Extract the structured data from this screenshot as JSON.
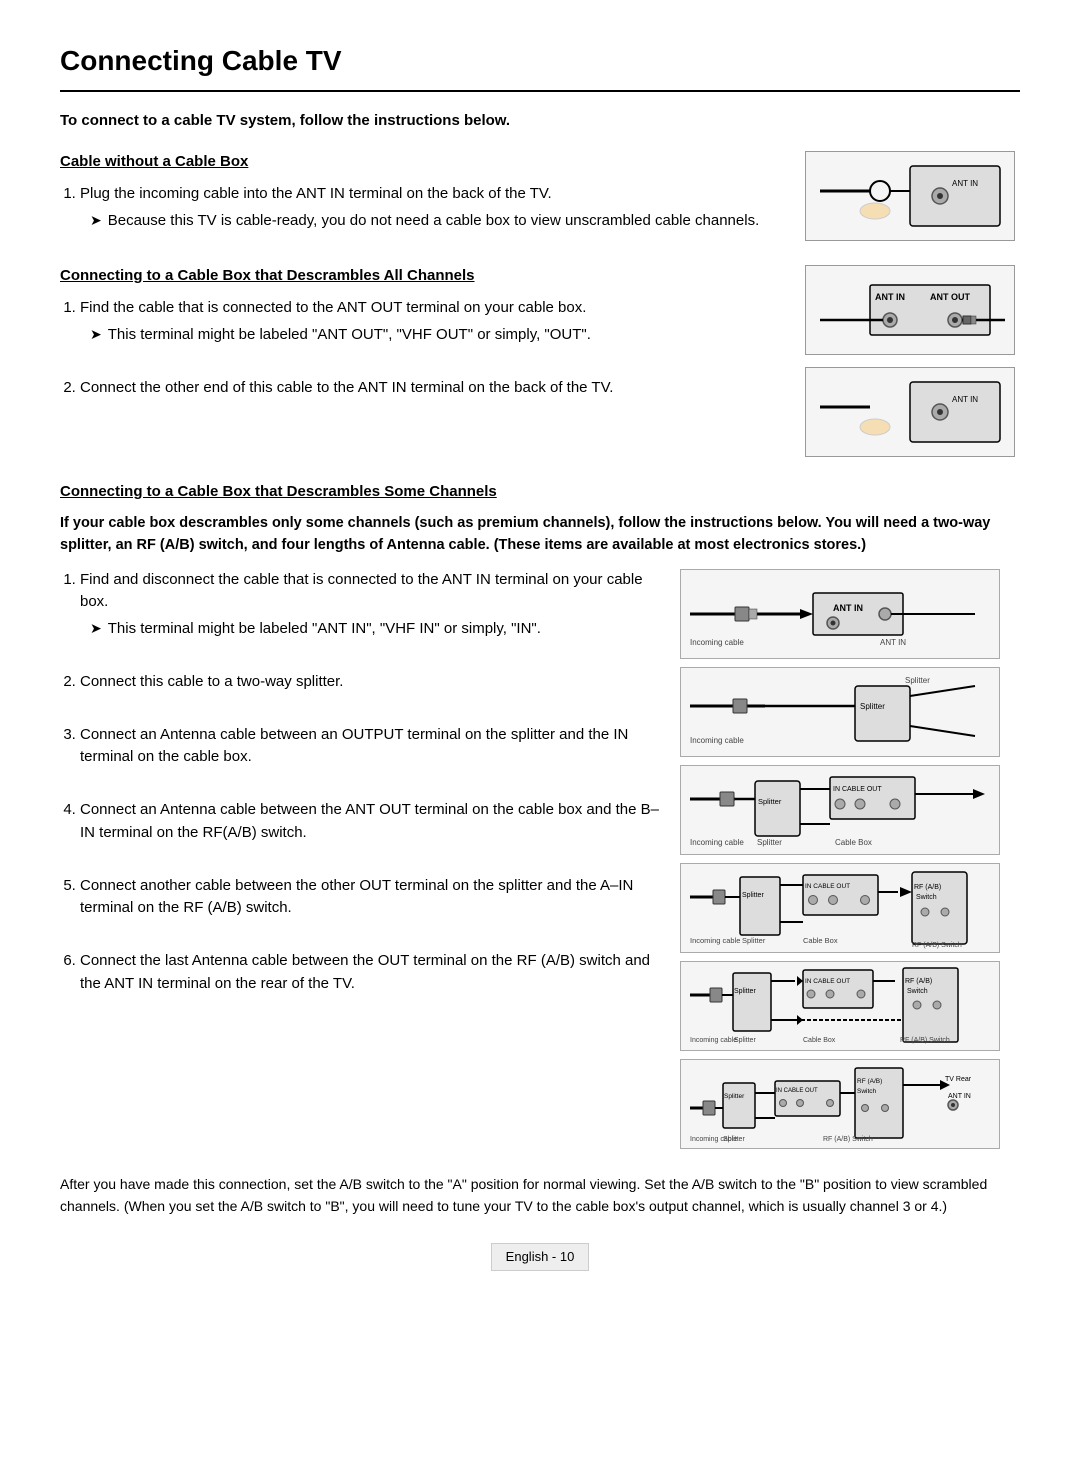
{
  "page": {
    "title": "Connecting Cable TV",
    "intro": "To connect to a cable TV system, follow the instructions below.",
    "section1": {
      "heading": "Cable without a Cable Box",
      "steps": [
        {
          "num": "1",
          "text": "Plug the incoming cable into the ANT IN terminal on the back of the TV.",
          "sub": "Because this TV is cable-ready, you do not need a cable box to view unscrambled cable channels."
        }
      ]
    },
    "section2": {
      "heading": "Connecting to a Cable Box that Descrambles All Channels",
      "steps": [
        {
          "num": "1",
          "text": "Find the cable that is connected to the ANT OUT terminal on your cable box.",
          "sub": "This terminal might be labeled \"ANT OUT\", \"VHF OUT\" or simply, \"OUT\"."
        },
        {
          "num": "2",
          "text": "Connect the other end of this cable to the ANT IN terminal on the back of the TV.",
          "sub": null
        }
      ]
    },
    "section3": {
      "heading": "Connecting to a Cable Box that Descrambles Some Channels",
      "bold_intro": "If your cable box descrambles only some channels (such as premium channels), follow the instructions below. You will need a two-way splitter, an RF (A/B) switch, and four lengths of Antenna cable. (These items are available at most electronics stores.)",
      "steps": [
        {
          "num": "1",
          "text": "Find and disconnect the cable that is connected to the ANT IN terminal on your cable box.",
          "sub": "This terminal might be labeled \"ANT IN\", \"VHF IN\" or simply, \"IN\"."
        },
        {
          "num": "2",
          "text": "Connect this cable to a two-way splitter.",
          "sub": null
        },
        {
          "num": "3",
          "text": "Connect an Antenna cable between an OUTPUT terminal on the splitter and the IN terminal on the cable box.",
          "sub": null
        },
        {
          "num": "4",
          "text": "Connect an Antenna cable between the ANT OUT terminal on the cable box and the B–IN terminal on the RF(A/B) switch.",
          "sub": null
        },
        {
          "num": "5",
          "text": "Connect another cable between the other OUT terminal on the splitter and the A–IN terminal on the RF (A/B) switch.",
          "sub": null
        },
        {
          "num": "6",
          "text": "Connect the last Antenna cable between the OUT terminal on the RF (A/B) switch and the ANT IN terminal on the rear of the TV.",
          "sub": null
        }
      ],
      "diagram_labels": {
        "incoming_cable": "Incoming cable",
        "splitter": "Splitter",
        "cable_box": "Cable Box",
        "rf_ab_switch": "RF (A/B) Switch",
        "ant_in": "ANT IN",
        "ant_out": "ANT OUT",
        "in_label": "IN",
        "cable_label": "CABLE",
        "out_label": "OUT",
        "tv_rear": "TV Rear",
        "ant_in_tv": "ANT IN"
      }
    },
    "footer": {
      "text": "After you have made this connection, set the A/B switch to the \"A\" position for normal viewing. Set the A/B switch to the \"B\" position to view scrambled channels. (When you set the A/B switch to \"B\", you will need to tune your TV to the cable box's output channel, which is usually channel 3 or 4.)",
      "page_label": "English - 10"
    }
  }
}
